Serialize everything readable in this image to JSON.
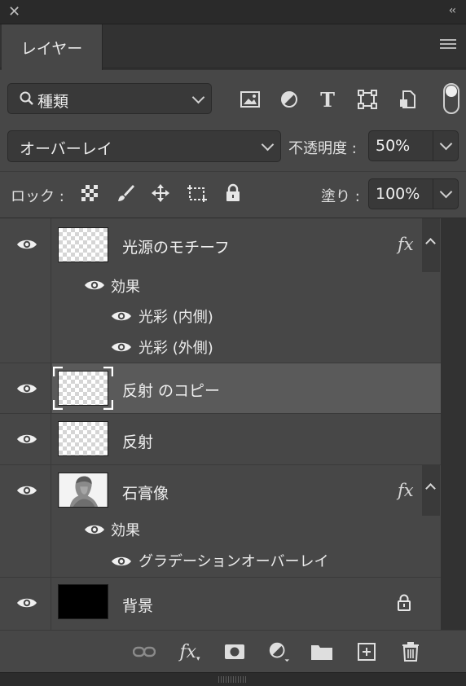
{
  "panel": {
    "tab_label": "レイヤー",
    "filter_dropdown": "種類",
    "blend_mode": "オーバーレイ",
    "opacity_label": "不透明度 :",
    "opacity_value": "50%",
    "lock_label": "ロック :",
    "fill_label": "塗り :",
    "fill_value": "100%"
  },
  "layers": [
    {
      "name": "光源のモチーフ",
      "fx": "fx",
      "effects_label": "効果",
      "effects": [
        "光彩 (内側)",
        "光彩 (外側)"
      ]
    },
    {
      "name": "反射 のコピー",
      "selected": true
    },
    {
      "name": "反射"
    },
    {
      "name": "石膏像",
      "fx": "fx",
      "effects_label": "効果",
      "effects": [
        "グラデーションオーバーレイ"
      ]
    },
    {
      "name": "背景",
      "locked": true
    }
  ],
  "footer": {
    "fx_label": "fx"
  },
  "colors": {
    "panel_bg": "#474747",
    "selected_row": "#5a5a5a",
    "dark_bg": "#323232"
  }
}
